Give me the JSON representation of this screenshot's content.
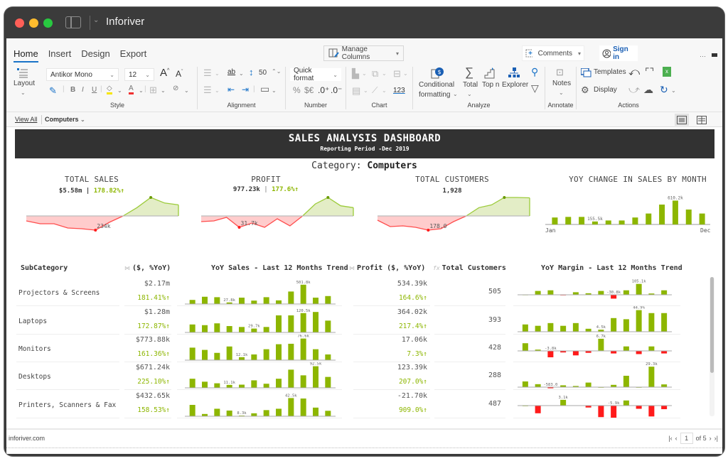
{
  "window": {
    "title": "Inforiver"
  },
  "ribbon": {
    "tabs": [
      {
        "label": "Home",
        "active": true
      },
      {
        "label": "Insert",
        "active": false
      },
      {
        "label": "Design",
        "active": false
      },
      {
        "label": "Export",
        "active": false
      }
    ],
    "manage_columns": "Manage Columns",
    "comments": "Comments",
    "sign_in": "Sign in",
    "more": "···",
    "layout": "Layout",
    "font_family": "Antikor Mono",
    "font_size": "12",
    "row_height": "50",
    "quick_format": "Quick format",
    "number_symbols": {
      "percent": "%",
      "currency": "$€",
      "inc_decimal": ".0⁺",
      "dec_decimal": ".0⁻"
    },
    "chart_123": "123",
    "analyze": {
      "conditional_formatting_line1": "Conditional",
      "conditional_formatting_line2": "formatting",
      "total": "Total",
      "top_n": "Top n",
      "explorer": "Explorer"
    },
    "notes": "Notes",
    "templates": "Templates",
    "display": "Display",
    "groups": {
      "style": "Style",
      "alignment": "Alignment",
      "number": "Number",
      "chart": "Chart",
      "analyze": "Analyze",
      "annotate": "Annotate",
      "actions": "Actions"
    }
  },
  "filterbar": {
    "view_all": "View All",
    "filter": "Computers"
  },
  "dashboard": {
    "title": "SALES ANALYSIS DASHBOARD",
    "subtitle": "Reporting Period -Dec 2019",
    "category_label": "Category:",
    "category_value": "Computers"
  },
  "kpis": [
    {
      "title": "TOTAL SALES",
      "value": "$5.58m",
      "sep": "|",
      "change": "178.82%",
      "min_label": "234k",
      "trend": [
        -0.35,
        -0.55,
        -0.55,
        -0.85,
        -0.9,
        -1.0,
        -0.45,
        0.0,
        0.45,
        1.0,
        0.7,
        0.6
      ]
    },
    {
      "title": "PROFIT",
      "value": "977.23k",
      "sep": "|",
      "change": "177.6%",
      "min_label": "31.7k",
      "trend": [
        -0.4,
        -0.35,
        -0.1,
        -0.8,
        -0.5,
        -0.8,
        -0.2,
        -0.7,
        0.0,
        0.65,
        1.0,
        0.55,
        0.45
      ]
    },
    {
      "title": "TOTAL CUSTOMERS",
      "value": "1,928",
      "min_label": "178.0",
      "trend": [
        -0.3,
        -0.75,
        -0.7,
        -0.8,
        -1.0,
        -0.9,
        -0.4,
        0.0,
        0.45,
        0.6,
        1.0,
        1.0,
        0.98
      ]
    },
    {
      "title": "YOY CHANGE IN SALES BY MONTH",
      "axis_start": "Jan",
      "axis_end": "Dec",
      "peak_label": "610.2k",
      "low_label": "155.5k",
      "bars": [
        0.35,
        0.38,
        0.38,
        0.15,
        0.2,
        0.2,
        0.35,
        0.55,
        1.0,
        1.2,
        0.75,
        0.55
      ]
    }
  ],
  "table": {
    "headers": {
      "subcategory": "SubCategory",
      "sales": "($, %YoY)",
      "sales_trend": "YoY Sales - Last 12 Months Trend",
      "profit": "Profit ($, %YoY)",
      "customers": "Total Customers",
      "margin_trend": "YoY Margin - Last 12 Months Trend"
    },
    "rows": [
      {
        "name": "Projectors & Screens",
        "sales": "$2.17m",
        "sales_yoy": "181.41%",
        "profit": "534.39k",
        "profit_yoy": "164.6%",
        "customers": "505",
        "sales_trend": [
          0.18,
          0.32,
          0.3,
          0.07,
          0.28,
          0.15,
          0.3,
          0.16,
          0.55,
          0.85,
          0.28,
          0.35
        ],
        "sales_label": "27.8k",
        "sales_label_idx": 3,
        "sales_peak": "501.8k",
        "sales_peak_idx": 9,
        "margin_trend": [
          0.01,
          0.3,
          0.35,
          -0.02,
          0.2,
          0.12,
          0.3,
          -0.3,
          0.35,
          0.85,
          0.1,
          0.35
        ],
        "margin_label": "-30.8k",
        "margin_label_idx": 7,
        "margin_peak": "105.1k",
        "margin_peak_idx": 9
      },
      {
        "name": "Laptops",
        "sales": "$1.28m",
        "sales_yoy": "172.87%",
        "profit": "364.02k",
        "profit_yoy": "217.4%",
        "customers": "393",
        "sales_trend": [
          0.35,
          0.32,
          0.4,
          0.28,
          0.24,
          0.17,
          0.24,
          0.75,
          0.75,
          0.85,
          0.9,
          0.52
        ],
        "sales_label": "29.7k",
        "sales_label_idx": 5,
        "sales_peak": "120.5k",
        "sales_peak_idx": 9,
        "margin_trend": [
          0.32,
          0.26,
          0.38,
          0.26,
          0.38,
          0.13,
          0.09,
          0.6,
          0.55,
          0.95,
          0.82,
          0.82
        ],
        "margin_label": "4.5k",
        "margin_label_idx": 6,
        "margin_peak": "44.9%",
        "margin_peak_idx": 9
      },
      {
        "name": "Monitors",
        "sales": "$773.88k",
        "sales_yoy": "161.36%",
        "profit": "17.06k",
        "profit_yoy": "7.3%",
        "customers": "428",
        "sales_trend": [
          0.55,
          0.45,
          0.32,
          0.6,
          0.13,
          0.25,
          0.48,
          0.7,
          0.72,
          0.95,
          0.48,
          0.25
        ],
        "sales_label": "12.1k",
        "sales_label_idx": 4,
        "sales_peak": "76.6k",
        "sales_peak_idx": 9,
        "margin_trend": [
          0.6,
          0.1,
          -0.5,
          -0.12,
          -0.35,
          -0.15,
          0.95,
          -0.2,
          0.35,
          -0.25,
          0.35,
          -0.2
        ],
        "margin_label": "-3.8k",
        "margin_label_idx": 2,
        "margin_peak": "6.7k",
        "margin_peak_idx": 6
      },
      {
        "name": "Desktops",
        "sales": "$671.24k",
        "sales_yoy": "225.10%",
        "profit": "123.39k",
        "profit_yoy": "207.0%",
        "customers": "288",
        "sales_trend": [
          0.4,
          0.27,
          0.2,
          0.13,
          0.14,
          0.33,
          0.18,
          0.4,
          0.8,
          0.55,
          0.95,
          0.48
        ],
        "sales_label": "11.1k",
        "sales_label_idx": 3,
        "sales_peak": "92.5k",
        "sales_peak_idx": 10,
        "margin_trend": [
          0.25,
          0.13,
          -0.05,
          0.08,
          0.05,
          0.2,
          0.0,
          0.1,
          0.5,
          0.0,
          0.9,
          0.12
        ],
        "margin_label": "-583.0",
        "margin_label_idx": 2,
        "margin_peak": "29.3k",
        "margin_peak_idx": 10
      },
      {
        "name": "Printers, Scanners & Fax",
        "sales": "$432.65k",
        "sales_yoy": "158.53%",
        "profit": "-21.70k",
        "profit_yoy": "909.0%",
        "customers": "487",
        "sales_trend": [
          0.5,
          0.1,
          0.33,
          0.25,
          0.03,
          0.13,
          0.27,
          0.33,
          0.8,
          0.78,
          0.38,
          0.24
        ],
        "sales_label": "8.3k",
        "sales_label_idx": 4,
        "sales_peak": "42.5k",
        "sales_peak_idx": 8,
        "margin_trend": [
          0.0,
          -0.6,
          0.02,
          0.45,
          0.02,
          -0.15,
          -0.9,
          -0.95,
          0.4,
          -0.25,
          -0.85,
          -0.28
        ],
        "margin_label": "-5.9k",
        "margin_label_idx": 7,
        "margin_peak": "3.1k",
        "margin_peak_idx": 3
      }
    ]
  },
  "footer": {
    "link": "inforiver.com",
    "page": "1",
    "of_pages": "of 5"
  },
  "colors": {
    "positive": "#8db600",
    "negative": "#ff1a1a",
    "header_bg": "#323232",
    "accent": "#1a73c8"
  }
}
